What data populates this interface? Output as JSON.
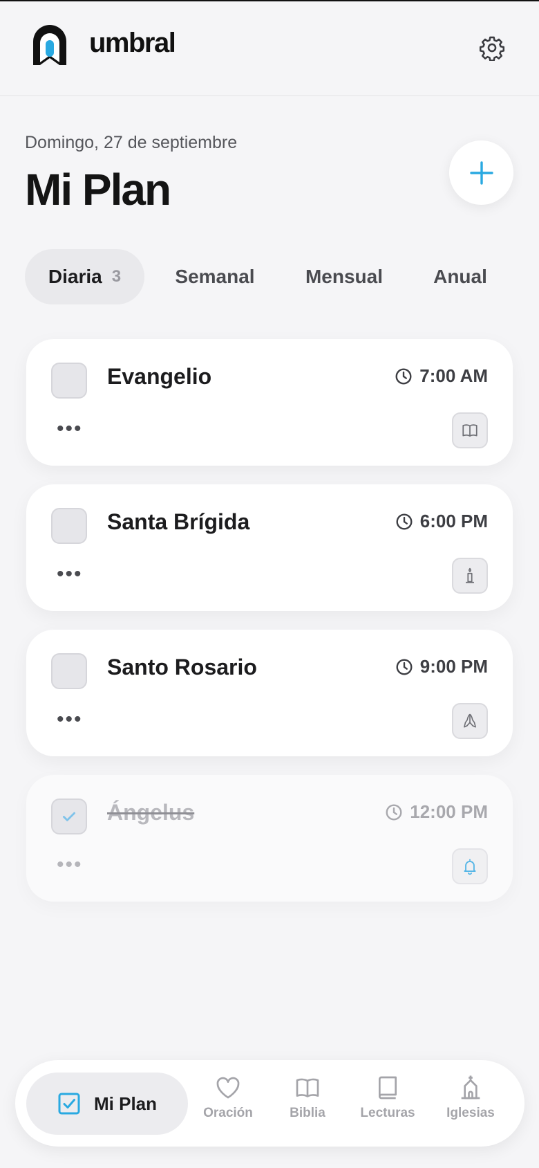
{
  "app": {
    "name": "umbral"
  },
  "header": {
    "date": "Domingo, 27 de septiembre",
    "title": "Mi Plan"
  },
  "tabs": [
    {
      "label": "Diaria",
      "count": "3",
      "active": true
    },
    {
      "label": "Semanal"
    },
    {
      "label": "Mensual"
    },
    {
      "label": "Anual"
    }
  ],
  "tasks": [
    {
      "title": "Evangelio",
      "time": "7:00 AM",
      "done": false,
      "icon": "book-icon"
    },
    {
      "title": "Santa Brígida",
      "time": "6:00 PM",
      "done": false,
      "icon": "candle-icon"
    },
    {
      "title": "Santo Rosario",
      "time": "9:00 PM",
      "done": false,
      "icon": "praying-hands-icon"
    },
    {
      "title": "Ángelus",
      "time": "12:00 PM",
      "done": true,
      "icon": "bell-icon"
    }
  ],
  "card_menu": "•••",
  "bottom_nav": [
    {
      "label": "Mi Plan",
      "icon": "checkbox-icon",
      "active": true
    },
    {
      "label": "Oración",
      "icon": "heart-icon"
    },
    {
      "label": "Biblia",
      "icon": "open-book-icon"
    },
    {
      "label": "Lecturas",
      "icon": "book-icon"
    },
    {
      "label": "Iglesias",
      "icon": "church-icon"
    }
  ],
  "colors": {
    "accent": "#29a9e1",
    "background": "#f5f5f7",
    "text": "#1c1c1e",
    "muted": "#a4a4a9"
  }
}
